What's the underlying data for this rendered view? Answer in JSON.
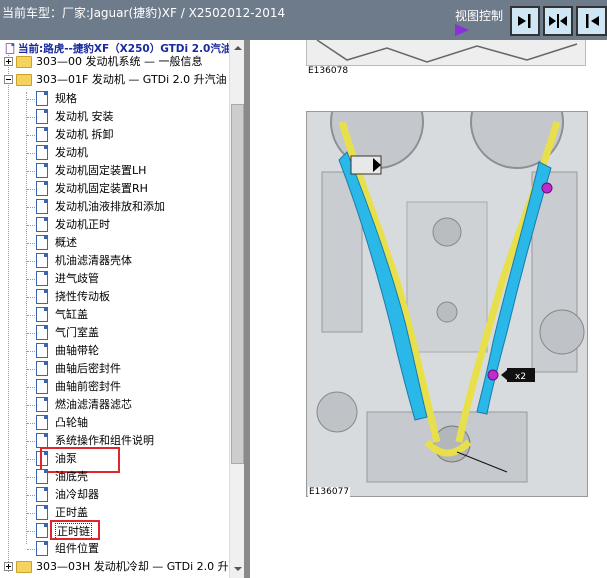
{
  "header": {
    "title": "当前车型：厂家:Jaguar(捷豹)XF / X2502012-2014",
    "view_control_label": "视图控制",
    "accent_color": "#8b2fd8",
    "buttons": [
      {
        "name": "collapse-left-button",
        "icon": "arrow-right-bar-icon"
      },
      {
        "name": "center-split-button",
        "icon": "arrows-inward-icon"
      },
      {
        "name": "collapse-right-button",
        "icon": "bar-arrow-left-icon"
      }
    ]
  },
  "tree": {
    "root_label": "当前:路虎--捷豹XF（X250）GTDi 2.0汽油",
    "items": [
      {
        "label": "303—00 发动机系统 — 一般信息",
        "type": "folder",
        "expander": "plus"
      },
      {
        "label": "303—01F 发动机 — GTDi 2.0 升汽油",
        "type": "folder",
        "expander": "minus"
      },
      {
        "label": "规格",
        "type": "doc"
      },
      {
        "label": "发动机 安装",
        "type": "doc"
      },
      {
        "label": "发动机 拆卸",
        "type": "doc"
      },
      {
        "label": "发动机",
        "type": "doc"
      },
      {
        "label": "发动机固定装置LH",
        "type": "doc"
      },
      {
        "label": "发动机固定装置RH",
        "type": "doc"
      },
      {
        "label": "发动机油液排放和添加",
        "type": "doc"
      },
      {
        "label": "发动机正时",
        "type": "doc"
      },
      {
        "label": "概述",
        "type": "doc"
      },
      {
        "label": "机油滤清器壳体",
        "type": "doc"
      },
      {
        "label": "进气歧管",
        "type": "doc"
      },
      {
        "label": "挠性传动板",
        "type": "doc"
      },
      {
        "label": "气缸盖",
        "type": "doc"
      },
      {
        "label": "气门室盖",
        "type": "doc"
      },
      {
        "label": "曲轴带轮",
        "type": "doc"
      },
      {
        "label": "曲轴后密封件",
        "type": "doc"
      },
      {
        "label": "曲轴前密封件",
        "type": "doc"
      },
      {
        "label": "燃油滤清器滤芯",
        "type": "doc"
      },
      {
        "label": "凸轮轴",
        "type": "doc"
      },
      {
        "label": "系统操作和组件说明",
        "type": "doc"
      },
      {
        "label": "油泵",
        "type": "doc",
        "highlighted": true
      },
      {
        "label": "油底壳",
        "type": "doc"
      },
      {
        "label": "油冷却器",
        "type": "doc"
      },
      {
        "label": "正时盖",
        "type": "doc"
      },
      {
        "label": "正时链",
        "type": "doc",
        "highlighted": true,
        "selected": true
      },
      {
        "label": "组件位置",
        "type": "doc"
      },
      {
        "label": "303—03H 发动机冷却 — GTDi 2.0 升",
        "type": "folder",
        "expander": "plus"
      }
    ]
  },
  "content": {
    "figure1_label": "E136078",
    "figure2_label": "E136077",
    "callout_label": "x2",
    "colors": {
      "guide_blue": "#2ab8e8",
      "chain_yellow": "#e8e04a",
      "bolt_purple": "#c02bd0",
      "highlight_red": "#e0262d"
    }
  }
}
